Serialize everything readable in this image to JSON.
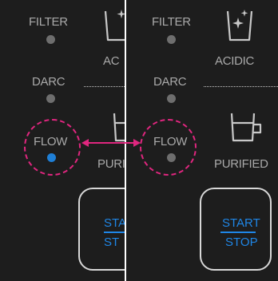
{
  "left_panel": {
    "filter_label": "FILTER",
    "darc_label": "DARC",
    "flow_label": "FLOW",
    "acidic_label": "AC",
    "purified_label": "PURI",
    "start_label": "STA",
    "stop_label": "ST"
  },
  "right_panel": {
    "filter_label": "FILTER",
    "darc_label": "DARC",
    "flow_label": "FLOW",
    "acidic_label": "ACIDIC",
    "purified_label": "PURIFIED",
    "start_label": "START",
    "stop_label": "STOP"
  },
  "icons": {
    "acidic": "glass-with-sparkles-icon",
    "purified": "mug-icon"
  },
  "colors": {
    "panel_background": "#1d1d1d",
    "label_gray": "#a9a9a9",
    "indicator_off": "#6e6e6e",
    "indicator_on": "#1f7fd6",
    "highlight": "#e0267f",
    "button_text": "#1f86e6"
  }
}
